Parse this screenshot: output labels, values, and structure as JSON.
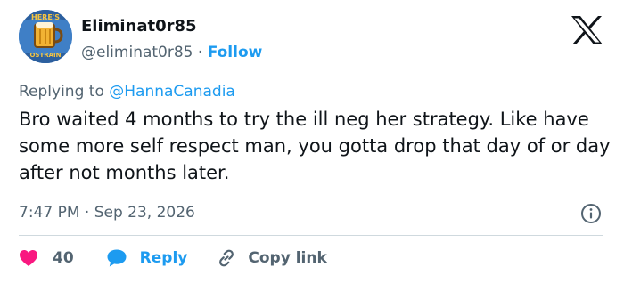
{
  "author": {
    "name": "Eliminat0r85",
    "handle": "@eliminat0r85",
    "separator": "·",
    "follow_label": "Follow",
    "avatar_text_top": "HERE'S",
    "avatar_text_bottom": "OSTRAIN"
  },
  "brand_icon": "x-logo",
  "reply_context": {
    "prefix": "Replying to",
    "mention": "@HannaCanadia"
  },
  "tweet": {
    "text": "Bro waited 4 months to try the ill neg her strategy. Like have some more self respect man, you gotta drop that day of or day after not months later.",
    "time": "7:47 PM",
    "separator": "·",
    "date": "Sep 23, 2026"
  },
  "actions": {
    "like_count": "40",
    "reply_label": "Reply",
    "copy_link_label": "Copy link"
  },
  "icons": [
    "x-logo",
    "info-icon",
    "heart-icon",
    "reply-bubble-icon",
    "link-icon"
  ],
  "colors": {
    "text": "#0f1419",
    "secondary": "#536471",
    "accent": "#1d9bf0",
    "like": "#f91880",
    "divider": "#cfd9de",
    "avatar_bg": "#3f7fc6"
  }
}
